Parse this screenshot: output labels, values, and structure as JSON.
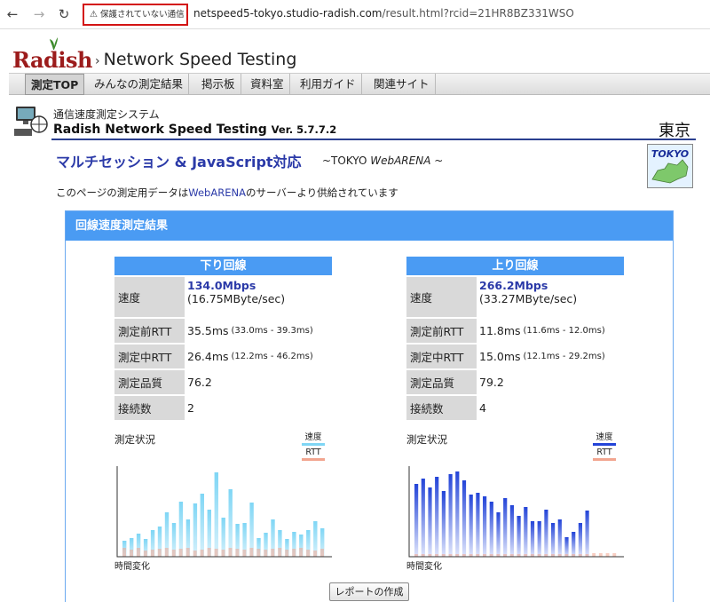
{
  "browser": {
    "security_label": "保護されていない通信",
    "url_host": "netspeed5-tokyo.studio-radish.com",
    "url_path": "/result.html?rcid=21HR8BZ331WSO"
  },
  "site": {
    "logo_text": "Radish",
    "title": "Network Speed Testing",
    "menu": [
      "測定TOP",
      "みんなの測定結果",
      "掲示板",
      "資料室",
      "利用ガイド",
      "関連サイト"
    ]
  },
  "system": {
    "subtitle": "通信速度測定システム",
    "name": "Radish Network Speed Testing",
    "version": "Ver. 5.7.7.2",
    "city": "東京",
    "multi_title": "マルチセッション & JavaScript対応",
    "multi_sub_prefix": "~TOKYO ",
    "multi_sub_brand": "WebARENA",
    "multi_sub_suffix": " ~",
    "badge_text": "TOKYO",
    "notice_prefix": "このページの測定用データは",
    "notice_link": "WebARENA",
    "notice_suffix": "のサーバーより供給されています"
  },
  "result": {
    "panel_title": "回線速度測定結果",
    "labels": {
      "speed": "速度",
      "rtt_before": "測定前RTT",
      "rtt_during": "測定中RTT",
      "quality": "測定品質",
      "connections": "接続数"
    },
    "down": {
      "header": "下り回線",
      "speed": "134.0Mbps",
      "speed_bytes": "(16.75MByte/sec)",
      "rtt_before": "35.5ms",
      "rtt_before_range": "(33.0ms - 39.3ms)",
      "rtt_during": "26.4ms",
      "rtt_during_range": "(12.2ms - 46.2ms)",
      "quality": "76.2",
      "connections": "2"
    },
    "up": {
      "header": "上り回線",
      "speed": "266.2Mbps",
      "speed_bytes": "(33.27MByte/sec)",
      "rtt_before": "11.8ms",
      "rtt_before_range": "(11.6ms - 12.0ms)",
      "rtt_during": "15.0ms",
      "rtt_during_range": "(12.1ms - 29.2ms)",
      "quality": "79.2",
      "connections": "4"
    },
    "chart_title": "測定状況",
    "legend_speed": "速度",
    "legend_rtt": "RTT",
    "x_label": "時間変化",
    "report_button": "レポートの作成"
  },
  "colors": {
    "down_speed": "#7fd6f5",
    "up_speed": "#2344d8",
    "rtt": "#f2a58f",
    "header_blue": "#4a9bf3",
    "alert_red": "#d31414"
  },
  "chart_data": [
    {
      "type": "bar",
      "series": [
        {
          "name": "速度",
          "values": [
            0.18,
            0.21,
            0.26,
            0.2,
            0.3,
            0.34,
            0.5,
            0.38,
            0.62,
            0.42,
            0.6,
            0.71,
            0.53,
            0.95,
            0.44,
            0.76,
            0.37,
            0.38,
            0.61,
            0.21,
            0.27,
            0.42,
            0.3,
            0.2,
            0.28,
            0.25,
            0.3,
            0.4,
            0.32
          ]
        },
        {
          "name": "RTT",
          "values": [
            0.1,
            0.08,
            0.1,
            0.07,
            0.08,
            0.09,
            0.1,
            0.08,
            0.09,
            0.1,
            0.07,
            0.08,
            0.1,
            0.09,
            0.08,
            0.1,
            0.09,
            0.08,
            0.1,
            0.09,
            0.08,
            0.09,
            0.1,
            0.08,
            0.09,
            0.1,
            0.08,
            0.07,
            0.09
          ]
        }
      ],
      "xlabel": "時間変化"
    },
    {
      "type": "bar",
      "series": [
        {
          "name": "速度",
          "values": [
            0.82,
            0.88,
            0.78,
            0.9,
            0.74,
            0.93,
            0.96,
            0.86,
            0.7,
            0.72,
            0.68,
            0.62,
            0.5,
            0.66,
            0.58,
            0.46,
            0.56,
            0.4,
            0.4,
            0.53,
            0.38,
            0.42,
            0.22,
            0.28,
            0.38,
            0.52,
            0.0,
            0.0,
            0.0,
            0.0
          ]
        },
        {
          "name": "RTT",
          "values": [
            0.03,
            0.03,
            0.03,
            0.03,
            0.03,
            0.03,
            0.03,
            0.03,
            0.03,
            0.03,
            0.03,
            0.03,
            0.03,
            0.03,
            0.03,
            0.03,
            0.03,
            0.03,
            0.03,
            0.03,
            0.03,
            0.03,
            0.03,
            0.03,
            0.03,
            0.03,
            0.04,
            0.04,
            0.04,
            0.04
          ]
        }
      ],
      "xlabel": "時間変化"
    }
  ]
}
